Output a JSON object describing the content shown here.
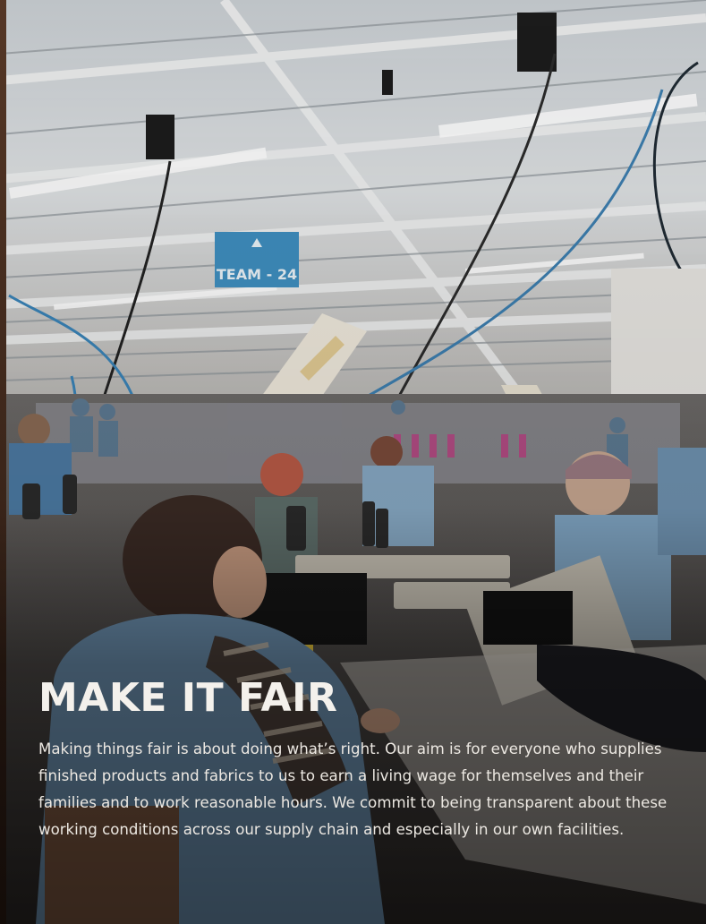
{
  "hero": {
    "image_alt": "garment factory workers at sewing machines",
    "sign_text": "TEAM - 24",
    "title": "MAKE IT FAIR",
    "body": "Making things fair is about doing what’s right. Our aim is for everyone who supplies finished products and fabrics to us to earn a living wage for themselves and their families and to work reasonable hours. We commit to being transparent about these working conditions across our supply chain and especially in our own facilities."
  },
  "colors": {
    "ceiling": "#d9dde0",
    "title_text": "#f4f1ec",
    "sign_blue": "#3f8fc0"
  }
}
